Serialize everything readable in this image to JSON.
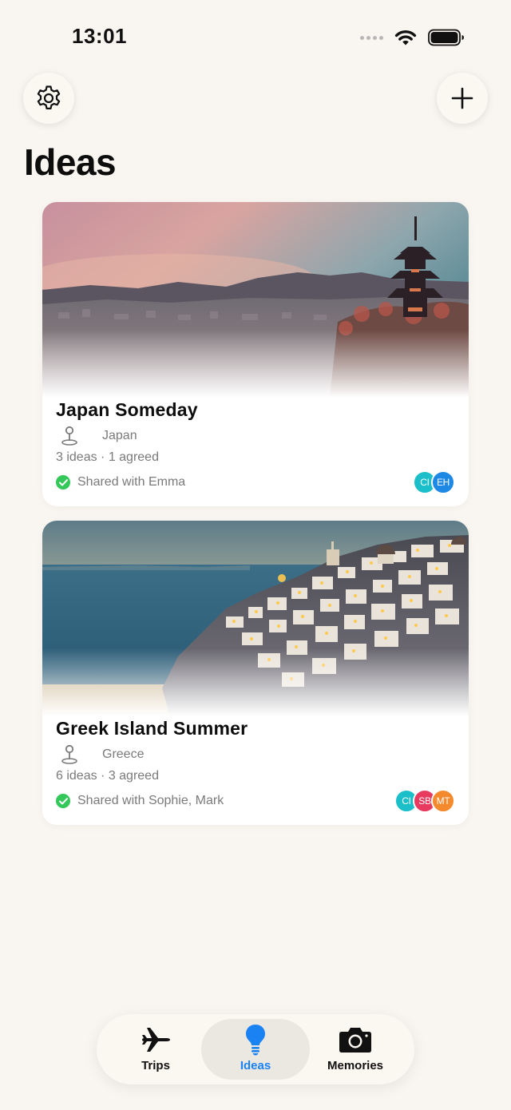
{
  "status_bar": {
    "time": "13:01"
  },
  "header": {
    "settings_icon": "gear-icon",
    "add_icon": "plus-icon",
    "title": "Ideas"
  },
  "cards": [
    {
      "title": "Japan Someday",
      "location": "Japan",
      "meta": "3 ideas · 1 agreed",
      "shared": "Shared with Emma",
      "image": "kyoto-pagoda-sunset",
      "avatars": [
        {
          "initials": "CI",
          "color": "#1bbfc9"
        },
        {
          "initials": "EH",
          "color": "#1e88e5"
        }
      ]
    },
    {
      "title": "Greek Island Summer",
      "location": "Greece",
      "meta": "6 ideas · 3 agreed",
      "shared": "Shared with Sophie, Mark",
      "image": "santorini-village-dusk",
      "avatars": [
        {
          "initials": "CI",
          "color": "#1bbfc9"
        },
        {
          "initials": "SB",
          "color": "#e8395f"
        },
        {
          "initials": "MT",
          "color": "#f58a2c"
        }
      ]
    }
  ],
  "tab_bar": {
    "tabs": [
      {
        "label": "Trips",
        "icon": "airplane-icon",
        "active": false
      },
      {
        "label": "Ideas",
        "icon": "lightbulb-icon",
        "active": true
      },
      {
        "label": "Memories",
        "icon": "camera-icon",
        "active": false
      }
    ],
    "active_color": "#1a82f2"
  }
}
